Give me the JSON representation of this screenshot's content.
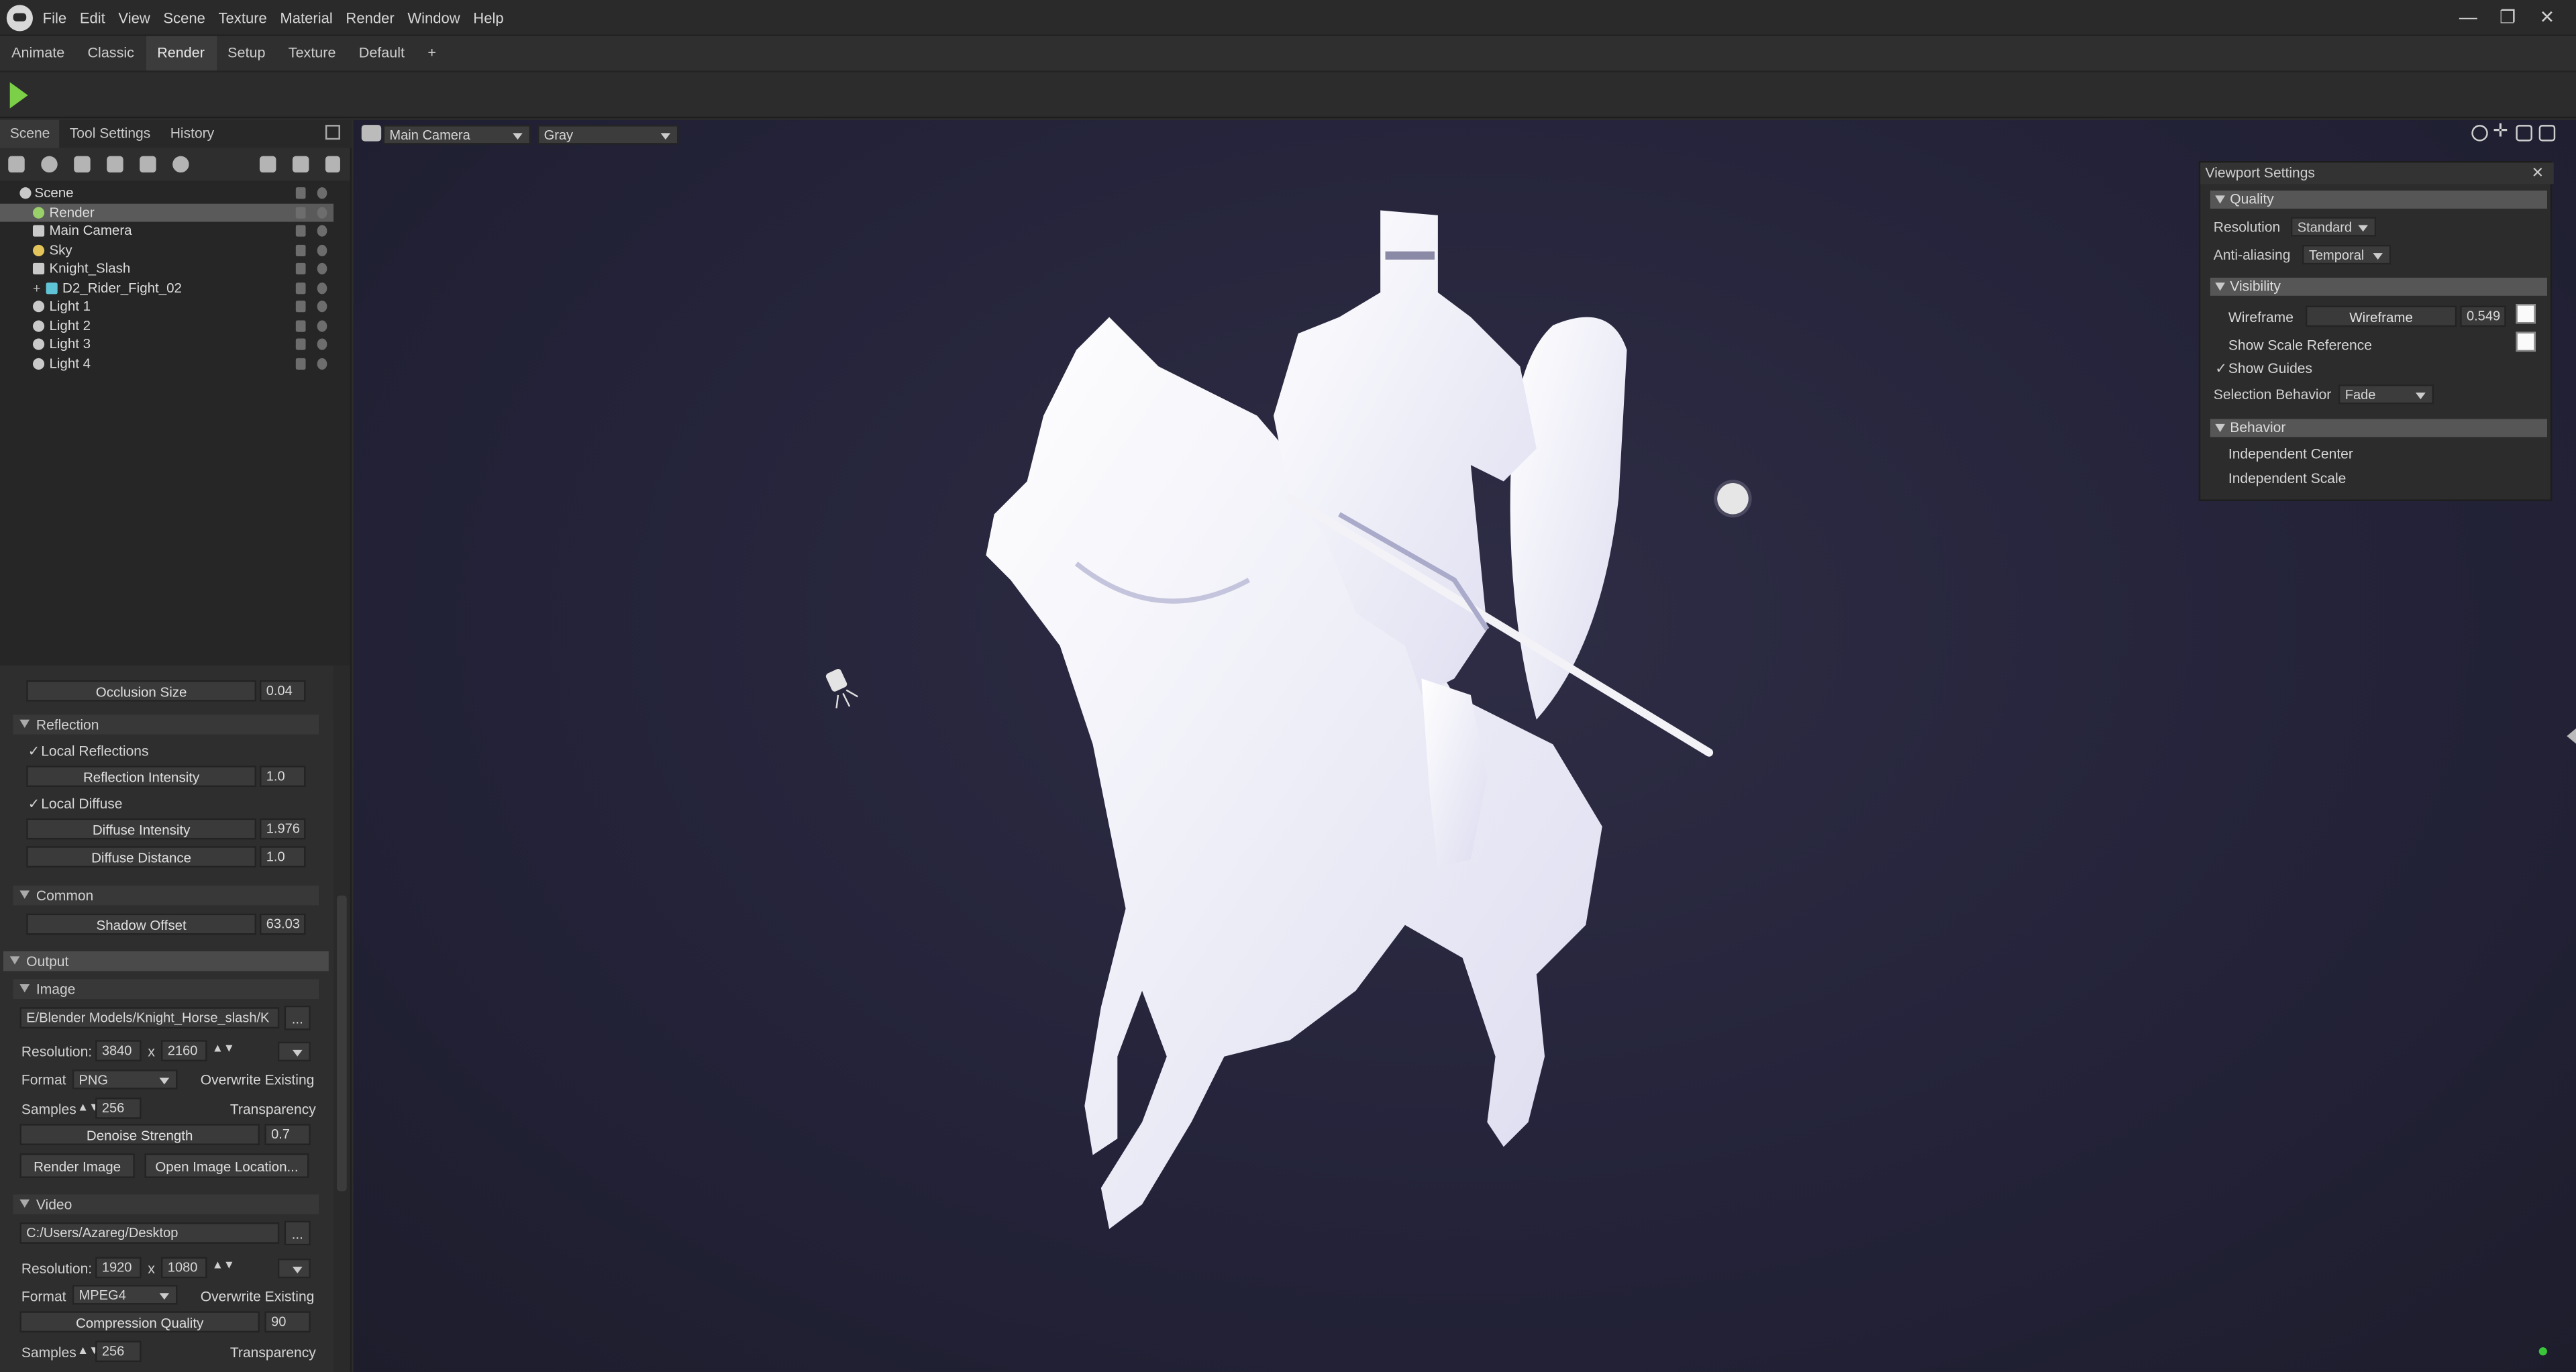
{
  "menubar": {
    "items": [
      "File",
      "Edit",
      "View",
      "Scene",
      "Texture",
      "Material",
      "Render",
      "Window",
      "Help"
    ],
    "window_buttons": [
      "—",
      "❐",
      "✕"
    ]
  },
  "workspace_tabs": {
    "items": [
      "Animate",
      "Classic",
      "Render",
      "Setup",
      "Texture",
      "Default",
      "+"
    ],
    "active": "Render"
  },
  "left_panel": {
    "tabs": [
      "Scene",
      "Tool Settings",
      "History"
    ],
    "active_tab": "Scene",
    "tree": [
      {
        "label": "Scene",
        "icon": "scene-icon",
        "depth": 0,
        "selected": false
      },
      {
        "label": "Render",
        "icon": "render-icon",
        "depth": 1,
        "selected": true
      },
      {
        "label": "Main Camera",
        "icon": "camera-icon",
        "depth": 1,
        "selected": false
      },
      {
        "label": "Sky",
        "icon": "sky-icon",
        "depth": 1,
        "selected": false
      },
      {
        "label": "Knight_Slash",
        "icon": "animation-icon",
        "depth": 1,
        "selected": false
      },
      {
        "label": "D2_Rider_Fight_02",
        "icon": "mesh-icon",
        "depth": 2,
        "selected": false
      },
      {
        "label": "Light 1",
        "icon": "light-icon",
        "depth": 1,
        "selected": false
      },
      {
        "label": "Light 2",
        "icon": "light-icon",
        "depth": 1,
        "selected": false
      },
      {
        "label": "Light 3",
        "icon": "light-icon",
        "depth": 1,
        "selected": false
      },
      {
        "label": "Light 4",
        "icon": "light-icon",
        "depth": 1,
        "selected": false
      }
    ]
  },
  "props": {
    "occlusion_size": {
      "label": "Occlusion Size",
      "value": "0.04"
    },
    "reflection": {
      "header": "Reflection",
      "local_reflections": "Local Reflections",
      "reflection_intensity": {
        "label": "Reflection Intensity",
        "value": "1.0"
      },
      "local_diffuse": "Local Diffuse",
      "diffuse_intensity": {
        "label": "Diffuse Intensity",
        "value": "1.976"
      },
      "diffuse_distance": {
        "label": "Diffuse Distance",
        "value": "1.0"
      }
    },
    "common": {
      "header": "Common",
      "shadow_offset": {
        "label": "Shadow Offset",
        "value": "63.03"
      }
    },
    "output": {
      "header": "Output",
      "image": {
        "header": "Image",
        "path": "E/Blender Models/Knight_Horse_slash/K",
        "browse": "...",
        "resolution_label": "Resolution:",
        "res_w": "3840",
        "x": "x",
        "res_h": "2160",
        "format_label": "Format",
        "format": "PNG",
        "overwrite": "Overwrite Existing",
        "samples_label": "Samples",
        "samples": "256",
        "transparency": "Transparency",
        "denoise": {
          "label": "Denoise Strength",
          "value": "0.7"
        },
        "render_btn": "Render Image",
        "open_btn": "Open Image Location..."
      },
      "video": {
        "header": "Video",
        "path": "C:/Users/Azareg/Desktop",
        "browse": "...",
        "resolution_label": "Resolution:",
        "res_w": "1920",
        "x": "x",
        "res_h": "1080",
        "format_label": "Format",
        "format": "MPEG4",
        "overwrite": "Overwrite Existing",
        "compression": {
          "label": "Compression Quality",
          "value": "90"
        },
        "samples_label": "Samples",
        "samples": "256",
        "transparency": "Transparency"
      }
    }
  },
  "viewport": {
    "camera": "Main Camera",
    "shading": "Gray",
    "settings": {
      "title": "Viewport Settings",
      "close": "✕",
      "quality": {
        "header": "Quality",
        "resolution_label": "Resolution",
        "resolution": "Standard",
        "aa_label": "Anti-aliasing",
        "aa": "Temporal"
      },
      "visibility": {
        "header": "Visibility",
        "wireframe": "Wireframe",
        "wireframe_slider": "Wireframe",
        "wireframe_value": "0.549",
        "scale_ref": "Show Scale Reference",
        "show_guides": "Show Guides",
        "selection_label": "Selection Behavior",
        "selection": "Fade"
      },
      "behavior": {
        "header": "Behavior",
        "center": "Independent Center",
        "scale": "Independent Scale"
      }
    }
  }
}
